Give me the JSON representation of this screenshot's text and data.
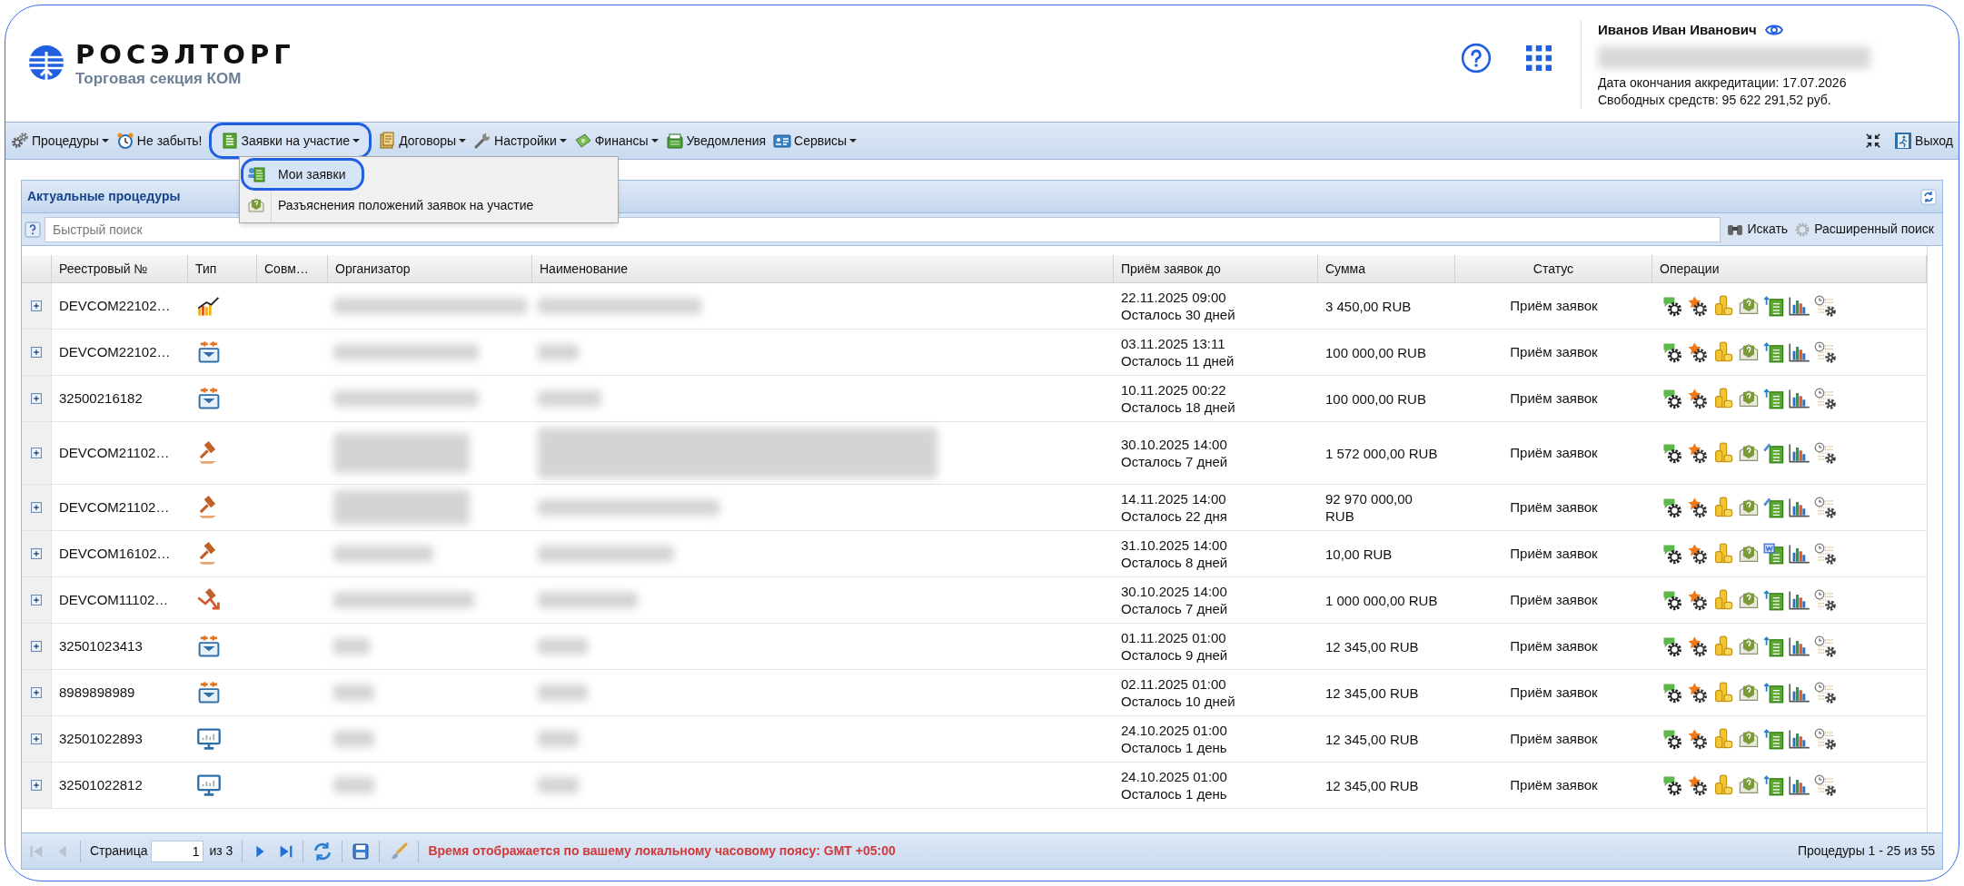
{
  "header": {
    "logo_title": "РОСЭЛТОРГ",
    "logo_subtitle": "Торговая секция КОМ",
    "user": {
      "name": "Иванов Иван Иванович",
      "accreditation": "Дата окончания аккредитации: 17.07.2026",
      "funds": "Свободных средств: 95 622 291,52 руб."
    }
  },
  "toolbar": {
    "items": [
      {
        "label": "Процедуры",
        "kind": "gears",
        "dropdown": true,
        "selected": false
      },
      {
        "label": "Не забыть!",
        "kind": "clock",
        "dropdown": false,
        "selected": false
      },
      {
        "label": "Заявки на участие",
        "kind": "form",
        "dropdown": true,
        "selected": true
      },
      {
        "label": "Договоры",
        "kind": "contract",
        "dropdown": true,
        "selected": false
      },
      {
        "label": "Настройки",
        "kind": "wrench",
        "dropdown": true,
        "selected": false
      },
      {
        "label": "Финансы",
        "kind": "money",
        "dropdown": true,
        "selected": false
      },
      {
        "label": "Уведомления",
        "kind": "folder",
        "dropdown": false,
        "selected": false
      },
      {
        "label": "Сервисы",
        "kind": "card",
        "dropdown": true,
        "selected": false
      }
    ],
    "exit": "Выход"
  },
  "menu": {
    "items": [
      {
        "label": "Мои заявки",
        "kind": "form_user",
        "highlighted": true
      },
      {
        "label": "Разъяснения положений заявок на участие",
        "kind": "envelope",
        "highlighted": false
      }
    ]
  },
  "panel": {
    "title": "Актуальные процедуры",
    "search": {
      "placeholder": "Быстрый поиск"
    },
    "search_button": "Искать",
    "advanced_search": "Расширенный поиск"
  },
  "table": {
    "columns": [
      "Реестровый №",
      "Тип",
      "Совм…",
      "Организатор",
      "Наименование",
      "Приём заявок до",
      "Сумма",
      "Статус",
      "Операции"
    ],
    "rows": [
      {
        "number": "DEVCOM22102…",
        "type_icon": {
          "kind": "chart"
        },
        "deadline": "22.11.2025 09:00",
        "remaining": "Осталось 30 дней",
        "sum": "3 450,00 RUB",
        "status": "Приём заявок",
        "document_op": {
          "kind": "upload"
        }
      },
      {
        "number": "DEVCOM22102…",
        "type_icon": {
          "kind": "tray"
        },
        "deadline": "03.11.2025 13:11",
        "remaining": "Осталось 11 дней",
        "sum": "100 000,00 RUB",
        "status": "Приём заявок",
        "document_op": {
          "kind": "upload"
        }
      },
      {
        "number": "32500216182",
        "type_icon": {
          "kind": "tray"
        },
        "deadline": "10.11.2025 00:22",
        "remaining": "Осталось 18 дней",
        "sum": "100 000,00 RUB",
        "status": "Приём заявок",
        "document_op": {
          "kind": "upload"
        }
      },
      {
        "number": "DEVCOM21102…",
        "type_icon": {
          "kind": "gavel"
        },
        "deadline": "30.10.2025 14:00",
        "remaining": "Осталось 7 дней",
        "sum": "1 572 000,00 RUB",
        "status": "Приём заявок",
        "document_op": {
          "kind": "edit"
        }
      },
      {
        "number": "DEVCOM21102…",
        "type_icon": {
          "kind": "gavel"
        },
        "deadline": "14.11.2025 14:00",
        "remaining": "Осталось 22 дня",
        "sum": "92 970 000,00 RUB",
        "status": "Приём заявок",
        "document_op": {
          "kind": "edit"
        }
      },
      {
        "number": "DEVCOM16102…",
        "type_icon": {
          "kind": "gavel"
        },
        "deadline": "31.10.2025 14:00",
        "remaining": "Осталось 8 дней",
        "sum": "10,00 RUB",
        "status": "Приём заявок",
        "document_op": {
          "kind": "word"
        }
      },
      {
        "number": "DEVCOM11102…",
        "type_icon": {
          "kind": "gavel_down"
        },
        "deadline": "30.10.2025 14:00",
        "remaining": "Осталось 7 дней",
        "sum": "1 000 000,00 RUB",
        "status": "Приём заявок",
        "document_op": {
          "kind": "upload"
        }
      },
      {
        "number": "32501023413",
        "type_icon": {
          "kind": "tray"
        },
        "deadline": "01.11.2025 01:00",
        "remaining": "Осталось 9 дней",
        "sum": "12 345,00 RUB",
        "status": "Приём заявок",
        "document_op": {
          "kind": "upload"
        }
      },
      {
        "number": "8989898989",
        "type_icon": {
          "kind": "tray"
        },
        "deadline": "02.11.2025 01:00",
        "remaining": "Осталось 10 дней",
        "sum": "12 345,00 RUB",
        "status": "Приём заявок",
        "document_op": {
          "kind": "upload"
        }
      },
      {
        "number": "32501022893",
        "type_icon": {
          "kind": "monitor"
        },
        "deadline": "24.10.2025 01:00",
        "remaining": "Осталось 1 день",
        "sum": "12 345,00 RUB",
        "status": "Приём заявок",
        "document_op": {
          "kind": "upload"
        }
      },
      {
        "number": "32501022812",
        "type_icon": {
          "kind": "monitor"
        },
        "deadline": "24.10.2025 01:00",
        "remaining": "Осталось 1 день",
        "sum": "12 345,00 RUB",
        "status": "Приём заявок",
        "document_op": {
          "kind": "upload"
        }
      }
    ]
  },
  "pager": {
    "nav": [
      {
        "kind": "first",
        "disabled": true
      },
      {
        "kind": "prev",
        "disabled": true
      }
    ],
    "page_label": "Страница",
    "page": "1",
    "of": "из 3",
    "nav_after": [
      {
        "kind": "next",
        "disabled": false
      },
      {
        "kind": "last",
        "disabled": false
      }
    ],
    "notice": "Время отображается по вашему локальному часовому поясу: GMT +05:00",
    "summary": "Процедуры 1 - 25 из 55"
  }
}
